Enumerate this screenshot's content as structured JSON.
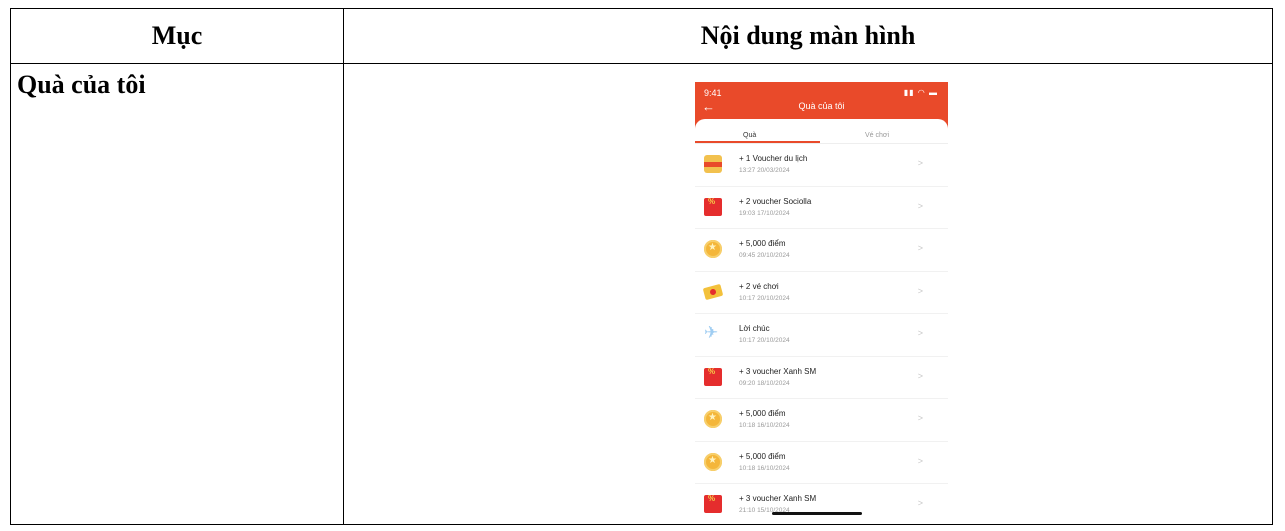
{
  "table": {
    "col1_header": "Mục",
    "col2_header": "Nội dung màn hình",
    "row_label": "Quà của tôi"
  },
  "phone": {
    "status_time": "9:41",
    "status_icons": "▮▮ ◠ ▬",
    "title": "Quà của tôi",
    "tabs": [
      {
        "label": "Quà",
        "active": true
      },
      {
        "label": "Vé chơi",
        "active": false
      }
    ],
    "items": [
      {
        "icon": "wallet-icon",
        "title": "+ 1 Voucher du lịch",
        "time": "13:27 20/03/2024"
      },
      {
        "icon": "red-envelope-icon",
        "title": "+ 2 voucher Sociolla",
        "time": "19:03 17/10/2024"
      },
      {
        "icon": "coin-icon",
        "title": "+ 5,000 điểm",
        "time": "09:45 20/10/2024"
      },
      {
        "icon": "ticket-icon",
        "title": "+ 2 vé chơi",
        "time": "10:17 20/10/2024"
      },
      {
        "icon": "paper-plane-icon",
        "title": "Lời chúc",
        "time": "10:17 20/10/2024"
      },
      {
        "icon": "red-envelope-icon",
        "title": "+ 3 voucher Xanh SM",
        "time": "09:20 18/10/2024"
      },
      {
        "icon": "coin-icon",
        "title": "+ 5,000 điểm",
        "time": "10:18 16/10/2024"
      },
      {
        "icon": "coin-icon",
        "title": "+ 5,000 điểm",
        "time": "10:18 16/10/2024"
      },
      {
        "icon": "red-envelope-icon",
        "title": "+ 3 voucher Xanh SM",
        "time": "21:10 15/10/2024"
      }
    ],
    "colors": {
      "accent": "#e94a2a"
    }
  }
}
